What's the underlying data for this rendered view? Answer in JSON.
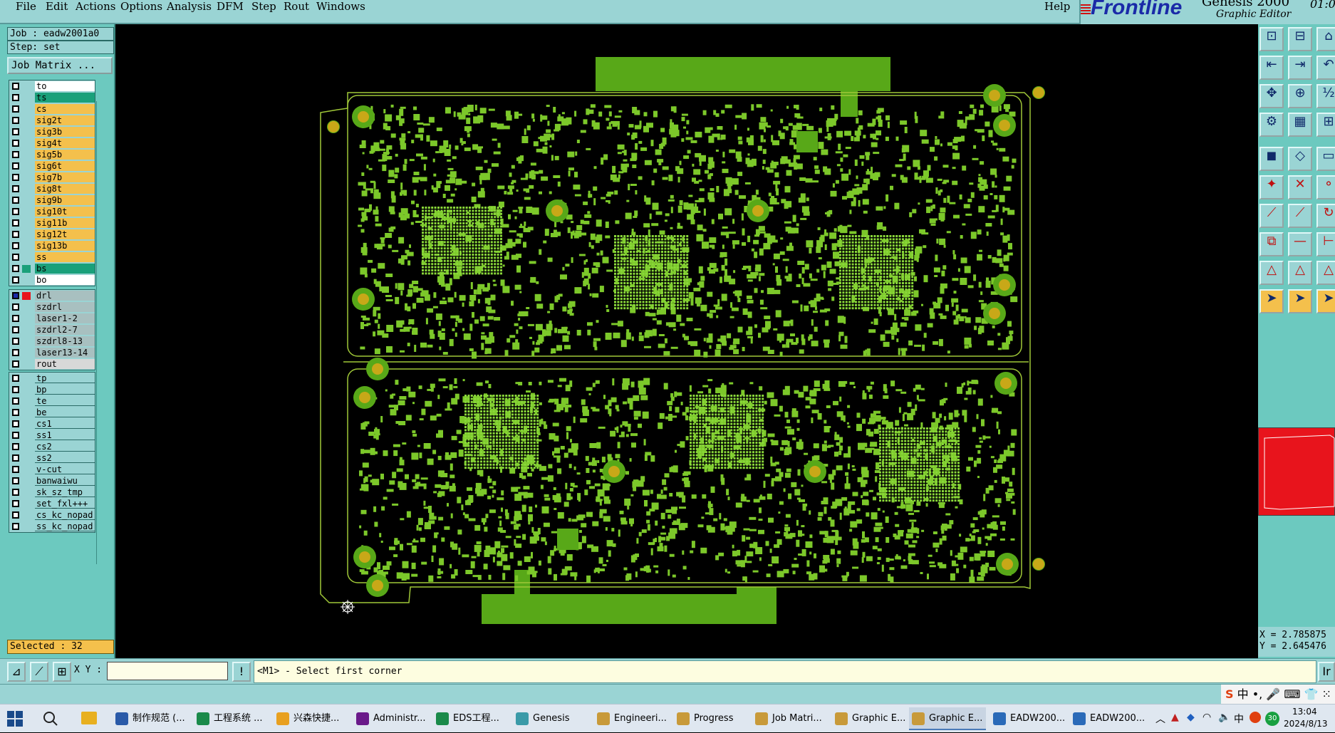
{
  "menu": [
    "File",
    "Edit",
    "Actions",
    "Options",
    "Analysis",
    "DFM",
    "Step",
    "Rout",
    "Windows"
  ],
  "help": "Help",
  "brand": {
    "logo": "Frontline",
    "product": "Genesis 2000",
    "subtitle": "Graphic Editor",
    "clock": "01:0"
  },
  "job": "Job : eadw2001a0",
  "step": "Step: set",
  "job_matrix_button": "Job Matrix ...",
  "board_layers": [
    {
      "name": "to",
      "color": "#ffffff"
    },
    {
      "name": "ts",
      "color": "#1aa07a"
    },
    {
      "name": "cs",
      "color": "#f4c04c"
    },
    {
      "name": "sig2t",
      "color": "#f4c04c"
    },
    {
      "name": "sig3b",
      "color": "#f4c04c"
    },
    {
      "name": "sig4t",
      "color": "#f4c04c"
    },
    {
      "name": "sig5b",
      "color": "#f4c04c"
    },
    {
      "name": "sig6t",
      "color": "#f4c04c"
    },
    {
      "name": "sig7b",
      "color": "#f4c04c"
    },
    {
      "name": "sig8t",
      "color": "#f4c04c"
    },
    {
      "name": "sig9b",
      "color": "#f4c04c"
    },
    {
      "name": "sig10t",
      "color": "#f4c04c"
    },
    {
      "name": "sig11b",
      "color": "#f4c04c"
    },
    {
      "name": "sig12t",
      "color": "#f4c04c"
    },
    {
      "name": "sig13b",
      "color": "#f4c04c"
    },
    {
      "name": "ss",
      "color": "#f4c04c"
    },
    {
      "name": "bs",
      "color": "#1aa07a"
    },
    {
      "name": "bo",
      "color": "#ffffff"
    }
  ],
  "drill_layers": [
    {
      "name": "drl",
      "color": "#a8c0c0"
    },
    {
      "name": "szdrl",
      "color": "#a8c0c0"
    },
    {
      "name": "laser1-2",
      "color": "#a8c0c0"
    },
    {
      "name": "szdrl2-7",
      "color": "#a8c0c0"
    },
    {
      "name": "szdrl8-13",
      "color": "#a8c0c0"
    },
    {
      "name": "laser13-14",
      "color": "#a8c0c0"
    },
    {
      "name": "rout",
      "color": "#d8d8d8"
    }
  ],
  "misc_layers": [
    "tp",
    "bp",
    "te",
    "be",
    "cs1",
    "ss1",
    "cs2",
    "ss2",
    "v-cut",
    "banwaiwu",
    "sk_sz_tmp",
    "set_fxl+++",
    "cs_kc_nopad",
    "ss_kc_nopad"
  ],
  "selected": "Selected : 32",
  "coords": {
    "x": "X = 2.785875",
    "y": "Y = 2.645476"
  },
  "xy_label": "X Y :",
  "xy_value": "",
  "prompt": "<M1> - Select first corner",
  "right_edge_label": "Ir",
  "ime": "中 •, 🎤 ⌨ 👕 ⁙",
  "taskbar": [
    {
      "label": "制作规范 (...",
      "color": "#2a5aa8"
    },
    {
      "label": "工程系统 ...",
      "color": "#1a8a4a"
    },
    {
      "label": "兴森快捷...",
      "color": "#e8a020"
    },
    {
      "label": "Administr...",
      "color": "#6a1a8a"
    },
    {
      "label": "EDS工程...",
      "color": "#1a8a4a"
    },
    {
      "label": "Genesis",
      "color": "#3a9aa8"
    },
    {
      "label": "Engineeri...",
      "color": "#c89a3a"
    },
    {
      "label": "Progress",
      "color": "#c89a3a"
    },
    {
      "label": "Job Matri...",
      "color": "#c89a3a"
    },
    {
      "label": "Graphic E...",
      "color": "#c89a3a"
    },
    {
      "label": "Graphic E...",
      "color": "#c89a3a"
    },
    {
      "label": "EADW200...",
      "color": "#2a6ab8"
    },
    {
      "label": "EADW200...",
      "color": "#2a6ab8"
    }
  ],
  "tray": {
    "lang": "中",
    "badge": "30",
    "time": "13:04",
    "date": "2024/8/13"
  },
  "colors": {
    "board_green": "#58a818",
    "pad_green": "#7cc82a",
    "outline": "#a0c838",
    "hole": "#c8a818"
  }
}
